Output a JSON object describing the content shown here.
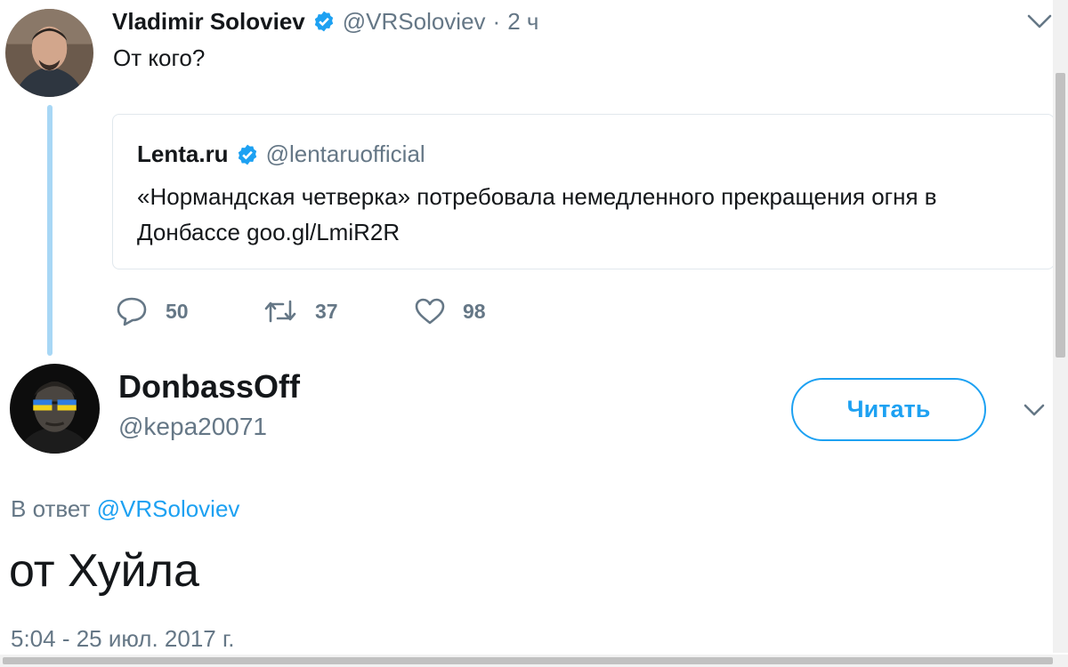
{
  "tweet1": {
    "author_name": "Vladimir Soloviev",
    "handle": "@VRSoloviev",
    "separator": "·",
    "time": "2 ч",
    "text": "От кого?",
    "quoted": {
      "author_name": "Lenta.ru",
      "handle": "@lentaruofficial",
      "text": "«Нормандская четверка» потребовала немедленного прекращения огня в Донбассе goo.gl/LmiR2R"
    },
    "actions": {
      "replies": "50",
      "retweets": "37",
      "likes": "98"
    }
  },
  "tweet2": {
    "author_name": "DonbassOff",
    "handle": "@kepa20071",
    "follow_label": "Читать",
    "reply_prefix": "В ответ",
    "reply_mention": "@VRSoloviev",
    "text": "от Хуйла",
    "timestamp": "5:04 - 25 июл. 2017 г."
  },
  "icons": {
    "verified": "verified-badge-icon",
    "caret": "chevron-down-icon",
    "reply": "reply-icon",
    "retweet": "retweet-icon",
    "like": "heart-icon"
  },
  "colors": {
    "accent": "#1da1f2",
    "secondary_text": "#657786",
    "thread_line": "#a8d7f5"
  }
}
